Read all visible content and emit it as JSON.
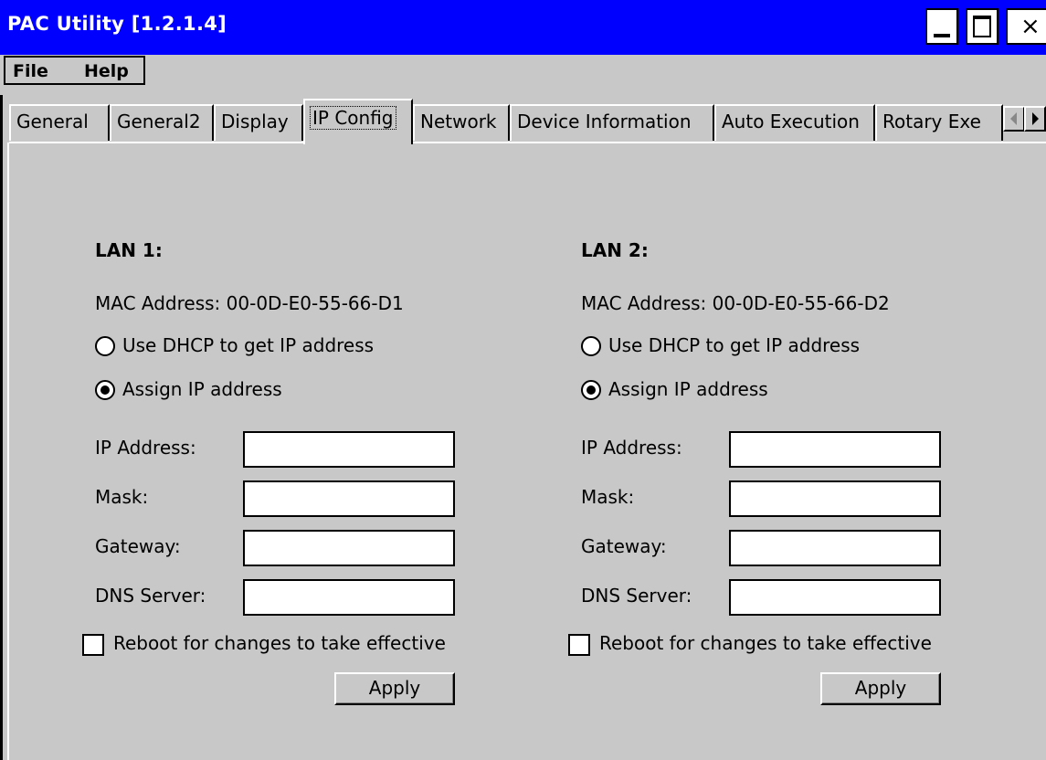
{
  "window": {
    "title": "PAC Utility  [1.2.1.4]",
    "buttons": {
      "minimize": "minimize-icon",
      "maximize": "maximize-icon",
      "close": "×"
    }
  },
  "menu": {
    "file": "File",
    "help": "Help"
  },
  "tabs": [
    {
      "label": "General"
    },
    {
      "label": "General2"
    },
    {
      "label": "Display"
    },
    {
      "label": "IP Config",
      "active": true
    },
    {
      "label": "Network"
    },
    {
      "label": "Device Information"
    },
    {
      "label": "Auto Execution"
    },
    {
      "label": "Rotary Exe"
    }
  ],
  "lan1": {
    "heading": "LAN 1:",
    "mac": "MAC Address: 00-0D-E0-55-66-D1",
    "dhcp_label": "Use DHCP to get IP address",
    "dhcp_selected": false,
    "assign_label": "Assign IP address",
    "assign_selected": true,
    "ip_label": "IP Address:",
    "mask_label": "Mask:",
    "gateway_label": "Gateway:",
    "dns_label": "DNS Server:",
    "ip_value": "",
    "mask_value": "",
    "gateway_value": "",
    "dns_value": "",
    "reboot_label": "Reboot for changes to take effective",
    "reboot_checked": false,
    "apply_label": "Apply"
  },
  "lan2": {
    "heading": "LAN 2:",
    "mac": "MAC Address: 00-0D-E0-55-66-D2",
    "dhcp_label": "Use DHCP to get IP address",
    "dhcp_selected": false,
    "assign_label": "Assign IP address",
    "assign_selected": true,
    "ip_label": "IP Address:",
    "mask_label": "Mask:",
    "gateway_label": "Gateway:",
    "dns_label": "DNS Server:",
    "ip_value": "",
    "mask_value": "",
    "gateway_value": "",
    "dns_value": "",
    "reboot_label": "Reboot for changes to take effective",
    "reboot_checked": false,
    "apply_label": "Apply"
  },
  "colors": {
    "titlebar": "#0000ff",
    "face": "#c8c8c8",
    "title_text": "#ffffff"
  }
}
